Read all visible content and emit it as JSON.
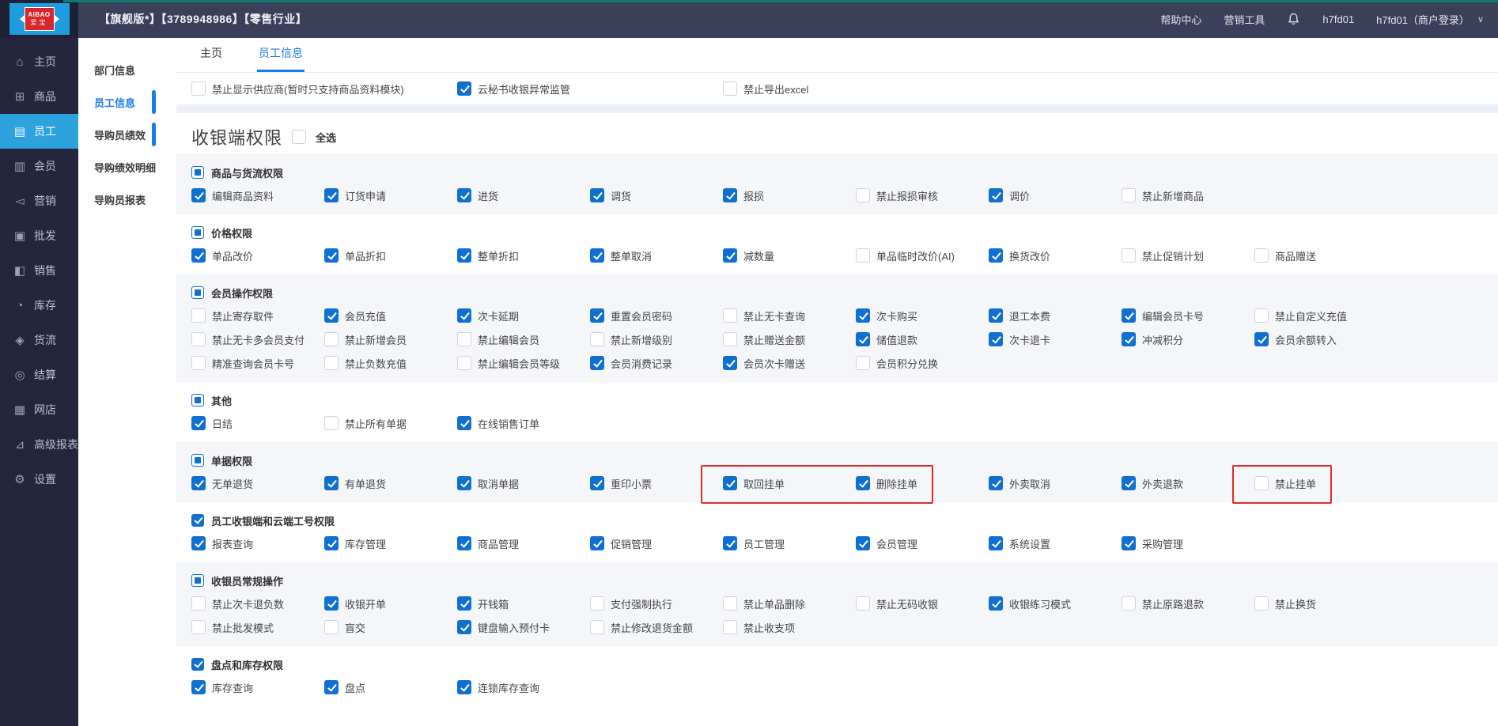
{
  "topbar": {
    "title": "【旗舰版*】【3789948986】【零售行业】",
    "help": "帮助中心",
    "marketing": "营销工具",
    "username": "h7fd01",
    "account": "h7fd01（商户登录）",
    "caret": "∨",
    "logo_text": "AIBAO",
    "logo_sub": "爱宝"
  },
  "sidebar": {
    "items": [
      {
        "label": "主页",
        "icon": "home-icon",
        "glyph": "⌂",
        "active": false
      },
      {
        "label": "商品",
        "icon": "goods-icon",
        "glyph": "⊞",
        "active": false
      },
      {
        "label": "员工",
        "icon": "staff-icon",
        "glyph": "▤",
        "active": true
      },
      {
        "label": "会员",
        "icon": "member-icon",
        "glyph": "▥",
        "active": false
      },
      {
        "label": "营销",
        "icon": "marketing-icon",
        "glyph": "◅",
        "active": false
      },
      {
        "label": "批发",
        "icon": "wholesale-icon",
        "glyph": "▣",
        "active": false
      },
      {
        "label": "销售",
        "icon": "sales-chart-icon",
        "glyph": "◧",
        "active": false
      },
      {
        "label": "库存",
        "icon": "inventory-pie-icon",
        "glyph": "◔",
        "active": false
      },
      {
        "label": "货流",
        "icon": "logistics-icon",
        "glyph": "◈",
        "active": false
      },
      {
        "label": "结算",
        "icon": "settlement-icon",
        "glyph": "◎",
        "active": false
      },
      {
        "label": "网店",
        "icon": "online-store-icon",
        "glyph": "▦",
        "active": false
      },
      {
        "label": "高级报表",
        "icon": "advanced-report-icon",
        "glyph": "⊿",
        "active": false
      },
      {
        "label": "设置",
        "icon": "settings-gear-icon",
        "glyph": "⚙",
        "active": false
      }
    ]
  },
  "submenu": {
    "items": [
      {
        "label": "部门信息",
        "active": false,
        "indicator": false
      },
      {
        "label": "员工信息",
        "active": true,
        "indicator": true
      },
      {
        "label": "导购员绩效",
        "active": false,
        "indicator": true
      },
      {
        "label": "导购绩效明细",
        "active": false,
        "indicator": false
      },
      {
        "label": "导购员报表",
        "active": false,
        "indicator": false
      }
    ]
  },
  "tabs": [
    {
      "label": "主页",
      "active": false
    },
    {
      "label": "员工信息",
      "active": true
    }
  ],
  "toprow": [
    {
      "label": "禁止显示供应商(暂时只支持商品资料模块)",
      "checked": false,
      "col": 0
    },
    {
      "label": "云秘书收银异常监管",
      "checked": true,
      "col": 2
    },
    {
      "label": "禁止导出excel",
      "checked": false,
      "col": 4
    }
  ],
  "page_title": {
    "text": "收银端权限",
    "select_all": "全选",
    "select_all_checked": false
  },
  "sections": [
    {
      "title": "商品与货流权限",
      "state": "indeterminate",
      "tinted": true,
      "rows": [
        [
          {
            "label": "编辑商品资料",
            "checked": true
          },
          {
            "label": "订货申请",
            "checked": true
          },
          {
            "label": "进货",
            "checked": true
          },
          {
            "label": "调货",
            "checked": true
          },
          {
            "label": "报损",
            "checked": true
          },
          {
            "label": "禁止报损审核",
            "checked": false
          },
          {
            "label": "调价",
            "checked": true
          },
          {
            "label": "禁止新增商品",
            "checked": false
          }
        ]
      ]
    },
    {
      "title": "价格权限",
      "state": "indeterminate",
      "tinted": false,
      "rows": [
        [
          {
            "label": "单品改价",
            "checked": true
          },
          {
            "label": "单品折扣",
            "checked": true
          },
          {
            "label": "整单折扣",
            "checked": true
          },
          {
            "label": "整单取消",
            "checked": true
          },
          {
            "label": "减数量",
            "checked": true
          },
          {
            "label": "单品临时改价(AI)",
            "checked": false
          },
          {
            "label": "换货改价",
            "checked": true
          },
          {
            "label": "禁止促销计划",
            "checked": false
          },
          {
            "label": "商品赠送",
            "checked": false
          }
        ]
      ]
    },
    {
      "title": "会员操作权限",
      "state": "indeterminate",
      "tinted": true,
      "rows": [
        [
          {
            "label": "禁止寄存取件",
            "checked": false
          },
          {
            "label": "会员充值",
            "checked": true
          },
          {
            "label": "次卡延期",
            "checked": true
          },
          {
            "label": "重置会员密码",
            "checked": true
          },
          {
            "label": "禁止无卡查询",
            "checked": false
          },
          {
            "label": "次卡购买",
            "checked": true
          },
          {
            "label": "退工本费",
            "checked": true
          },
          {
            "label": "编辑会员卡号",
            "checked": true
          },
          {
            "label": "禁止自定义充值",
            "checked": false
          }
        ],
        [
          {
            "label": "禁止无卡多会员支付",
            "checked": false
          },
          {
            "label": "禁止新增会员",
            "checked": false
          },
          {
            "label": "禁止编辑会员",
            "checked": false
          },
          {
            "label": "禁止新增级别",
            "checked": false
          },
          {
            "label": "禁止赠送金额",
            "checked": false
          },
          {
            "label": "储值退款",
            "checked": true
          },
          {
            "label": "次卡退卡",
            "checked": true
          },
          {
            "label": "冲减积分",
            "checked": true
          },
          {
            "label": "会员余额转入",
            "checked": true
          }
        ],
        [
          {
            "label": "精准查询会员卡号",
            "checked": false
          },
          {
            "label": "禁止负数充值",
            "checked": false
          },
          {
            "label": "禁止编辑会员等级",
            "checked": false
          },
          {
            "label": "会员消费记录",
            "checked": true
          },
          {
            "label": "会员次卡赠送",
            "checked": true
          },
          {
            "label": "会员积分兑换",
            "checked": false
          }
        ]
      ]
    },
    {
      "title": "其他",
      "state": "indeterminate",
      "tinted": false,
      "rows": [
        [
          {
            "label": "日结",
            "checked": true
          },
          {
            "label": "禁止所有单据",
            "checked": false
          },
          {
            "label": "在线销售订单",
            "checked": true
          }
        ]
      ]
    },
    {
      "title": "单据权限",
      "state": "indeterminate",
      "tinted": true,
      "rows": [
        [
          {
            "label": "无单退货",
            "checked": true
          },
          {
            "label": "有单退货",
            "checked": true
          },
          {
            "label": "取消单据",
            "checked": true
          },
          {
            "label": "重印小票",
            "checked": true
          },
          {
            "label": "取回挂单",
            "checked": true,
            "hl": 1
          },
          {
            "label": "删除挂单",
            "checked": true,
            "hl": 1
          },
          {
            "label": "外卖取消",
            "checked": true
          },
          {
            "label": "外卖退款",
            "checked": true
          },
          {
            "label": "禁止挂单",
            "checked": false,
            "hl": 2
          }
        ]
      ]
    },
    {
      "title": "员工收银端和云端工号权限",
      "state": "checked",
      "tinted": false,
      "rows": [
        [
          {
            "label": "报表查询",
            "checked": true
          },
          {
            "label": "库存管理",
            "checked": true
          },
          {
            "label": "商品管理",
            "checked": true
          },
          {
            "label": "促销管理",
            "checked": true
          },
          {
            "label": "员工管理",
            "checked": true
          },
          {
            "label": "会员管理",
            "checked": true
          },
          {
            "label": "系统设置",
            "checked": true
          },
          {
            "label": "采购管理",
            "checked": true
          }
        ]
      ]
    },
    {
      "title": "收银员常规操作",
      "state": "indeterminate",
      "tinted": true,
      "rows": [
        [
          {
            "label": "禁止次卡退负数",
            "checked": false
          },
          {
            "label": "收银开单",
            "checked": true
          },
          {
            "label": "开钱箱",
            "checked": true
          },
          {
            "label": "支付强制执行",
            "checked": false
          },
          {
            "label": "禁止单品删除",
            "checked": false
          },
          {
            "label": "禁止无码收银",
            "checked": false
          },
          {
            "label": "收银练习模式",
            "checked": true
          },
          {
            "label": "禁止原路退款",
            "checked": false
          },
          {
            "label": "禁止换货",
            "checked": false
          }
        ],
        [
          {
            "label": "禁止批发模式",
            "checked": false
          },
          {
            "label": "盲交",
            "checked": false
          },
          {
            "label": "键盘输入预付卡",
            "checked": true
          },
          {
            "label": "禁止修改退货金额",
            "checked": false
          },
          {
            "label": "禁止收支项",
            "checked": false
          }
        ]
      ]
    },
    {
      "title": "盘点和库存权限",
      "state": "checked",
      "tinted": false,
      "rows": [
        [
          {
            "label": "库存查询",
            "checked": true
          },
          {
            "label": "盘点",
            "checked": true
          },
          {
            "label": "连锁库存查询",
            "checked": true
          }
        ]
      ]
    }
  ],
  "colors": {
    "accent_blue": "#1070d2",
    "link_blue": "#1a7ce8",
    "sidebar_active": "#2da3dd",
    "highlight_red": "#e02b2b",
    "teal": "#0f7a6f"
  }
}
